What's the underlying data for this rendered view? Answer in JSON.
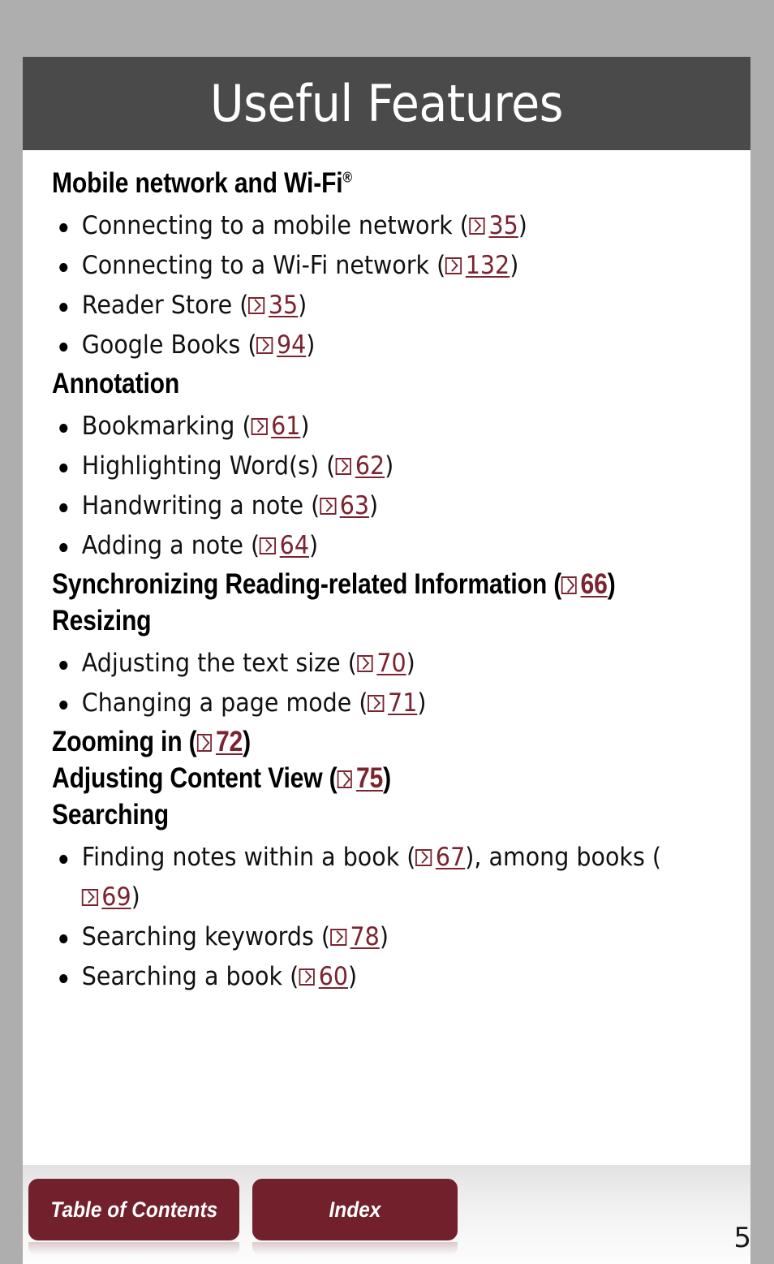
{
  "header": {
    "title": "Useful Features"
  },
  "colors": {
    "header_bar": "#4a4a4a",
    "accent_maroon": "#7a2430",
    "button_maroon": "#72202c",
    "page_backdrop": "#aeaeae",
    "sheet": "#ffffff"
  },
  "sections": [
    {
      "heading": "Mobile network and Wi-Fi",
      "heading_superscript": "®",
      "items": [
        {
          "text_before": "Connecting to a mobile network (",
          "page": "35",
          "text_after": ")"
        },
        {
          "text_before": "Connecting to a Wi-Fi network (",
          "page": "132",
          "text_after": ")"
        },
        {
          "text_before": "Reader Store (",
          "page": "35",
          "text_after": ")"
        },
        {
          "text_before": "Google Books (",
          "page": "94",
          "text_after": ")"
        }
      ]
    },
    {
      "heading": "Annotation",
      "items": [
        {
          "text_before": "Bookmarking (",
          "page": "61",
          "text_after": ")"
        },
        {
          "text_before": "Highlighting Word(s) (",
          "page": "62",
          "text_after": ")"
        },
        {
          "text_before": "Handwriting a note (",
          "page": "63",
          "text_after": ")"
        },
        {
          "text_before": "Adding a note (",
          "page": "64",
          "text_after": ")"
        }
      ]
    },
    {
      "heading": "Synchronizing Reading-related Information (",
      "heading_page": "66",
      "heading_after": ")",
      "items": []
    },
    {
      "heading": "Resizing",
      "items": [
        {
          "text_before": "Adjusting the text size (",
          "page": "70",
          "text_after": ")"
        },
        {
          "text_before": "Changing a page mode (",
          "page": "71",
          "text_after": ")"
        }
      ]
    },
    {
      "heading": "Zooming in (",
      "heading_page": "72",
      "heading_after": ")",
      "items": []
    },
    {
      "heading": "Adjusting Content View (",
      "heading_page": "75",
      "heading_after": ")",
      "items": []
    },
    {
      "heading": "Searching",
      "items": [
        {
          "text_before": "Finding notes within a book (",
          "page": "67",
          "text_after": "), among books (",
          "page2": "69",
          "text_after2": ")"
        },
        {
          "text_before": "Searching keywords (",
          "page": "78",
          "text_after": ")"
        },
        {
          "text_before": "Searching a book (",
          "page": "60",
          "text_after": ")"
        }
      ]
    }
  ],
  "footer": {
    "table_of_contents_label": "Table of Contents",
    "index_label": "Index",
    "page_number": "5"
  },
  "icons": {
    "page_reference": "page-reference-arrow-icon"
  }
}
